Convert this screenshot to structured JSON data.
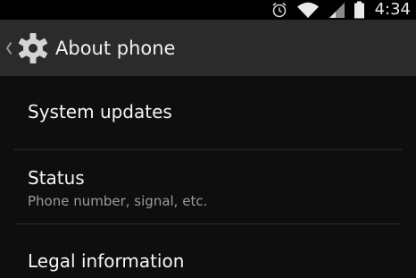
{
  "status_bar": {
    "time": "4:34",
    "icons": [
      "alarm-icon",
      "wifi-icon",
      "signal-icon",
      "battery-icon"
    ]
  },
  "action_bar": {
    "title": "About phone",
    "icon": "settings-gear-icon",
    "up_icon": "up-caret-icon"
  },
  "settings_list": [
    {
      "title": "System updates",
      "summary": ""
    },
    {
      "title": "Status",
      "summary": "Phone number, signal, etc."
    },
    {
      "title": "Legal information",
      "summary": ""
    }
  ],
  "colors": {
    "background": "#0e0e0e",
    "action_bar": "#2b2b2b",
    "status_bar": "#000000",
    "primary_text": "#f5f5f5",
    "secondary_text": "#9c9c9c",
    "divider": "#2a2a2a"
  }
}
